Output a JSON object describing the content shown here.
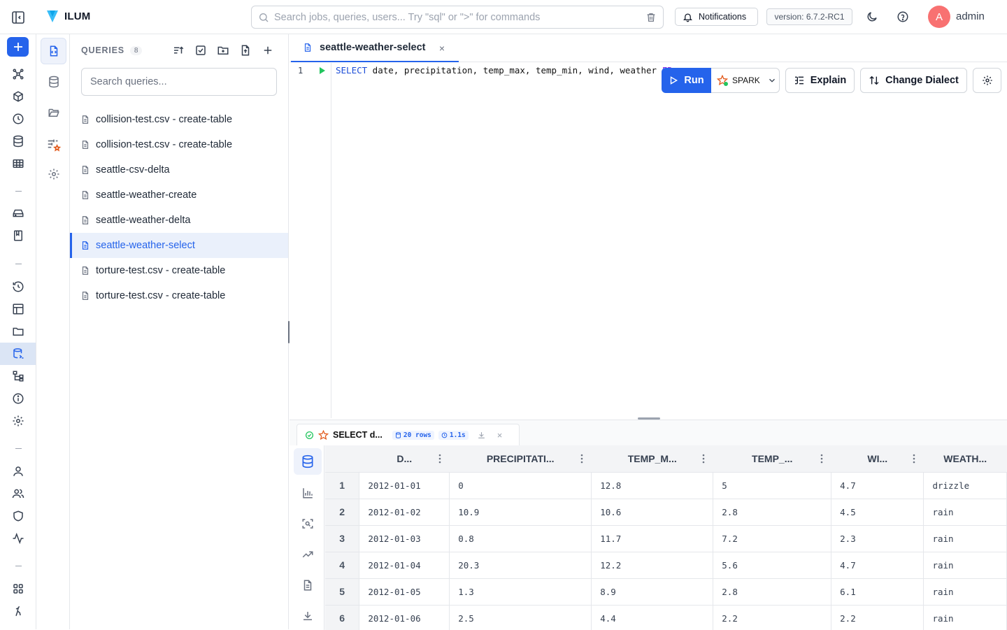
{
  "app": {
    "name": "ILUM"
  },
  "search": {
    "placeholder": "Search jobs, queries, users... Try \"sql\" or \">\" for commands"
  },
  "header": {
    "notifications_label": "Notifications",
    "version": "version: 6.7.2-RC1",
    "avatar_initial": "A",
    "username": "admin"
  },
  "queries": {
    "title": "QUERIES",
    "count": "8",
    "search_placeholder": "Search queries...",
    "items": [
      "collision-test.csv - create-table",
      "collision-test.csv - create-table",
      "seattle-csv-delta",
      "seattle-weather-create",
      "seattle-weather-delta",
      "seattle-weather-select",
      "torture-test.csv - create-table",
      "torture-test.csv - create-table"
    ],
    "selected_index": 5
  },
  "editor": {
    "tab_title": "seattle-weather-select",
    "tab_close": "×",
    "line_number": "1",
    "sql_keyword": "SELECT",
    "sql_columns": " date, precipitation, temp_max, temp_min, wind, weather ",
    "sql_from": "FROM"
  },
  "toolbar": {
    "run_label": "Run",
    "engine": "SPARK",
    "explain_label": "Explain",
    "change_dialect_label": "Change Dialect"
  },
  "result_tab": {
    "title": "SELECT d...",
    "rows_badge": "20 rows",
    "time_badge": "1.1s",
    "close": "×"
  },
  "table": {
    "columns": [
      "D...",
      "PRECIPITATI...",
      "TEMP_M...",
      "TEMP_...",
      "WI...",
      "WEATH..."
    ],
    "rows": [
      {
        "n": "1",
        "date": "2012-01-01",
        "precipitation": "0",
        "temp_max": "12.8",
        "temp_min": "5",
        "wind": "4.7",
        "weather": "drizzle"
      },
      {
        "n": "2",
        "date": "2012-01-02",
        "precipitation": "10.9",
        "temp_max": "10.6",
        "temp_min": "2.8",
        "wind": "4.5",
        "weather": "rain"
      },
      {
        "n": "3",
        "date": "2012-01-03",
        "precipitation": "0.8",
        "temp_max": "11.7",
        "temp_min": "7.2",
        "wind": "2.3",
        "weather": "rain"
      },
      {
        "n": "4",
        "date": "2012-01-04",
        "precipitation": "20.3",
        "temp_max": "12.2",
        "temp_min": "5.6",
        "wind": "4.7",
        "weather": "rain"
      },
      {
        "n": "5",
        "date": "2012-01-05",
        "precipitation": "1.3",
        "temp_max": "8.9",
        "temp_min": "2.8",
        "wind": "6.1",
        "weather": "rain"
      },
      {
        "n": "6",
        "date": "2012-01-06",
        "precipitation": "2.5",
        "temp_max": "4.4",
        "temp_min": "2.2",
        "wind": "2.2",
        "weather": "rain"
      }
    ]
  },
  "colors": {
    "accent": "#2563eb",
    "avatar": "#f87171",
    "spark": "#e25a1c"
  }
}
